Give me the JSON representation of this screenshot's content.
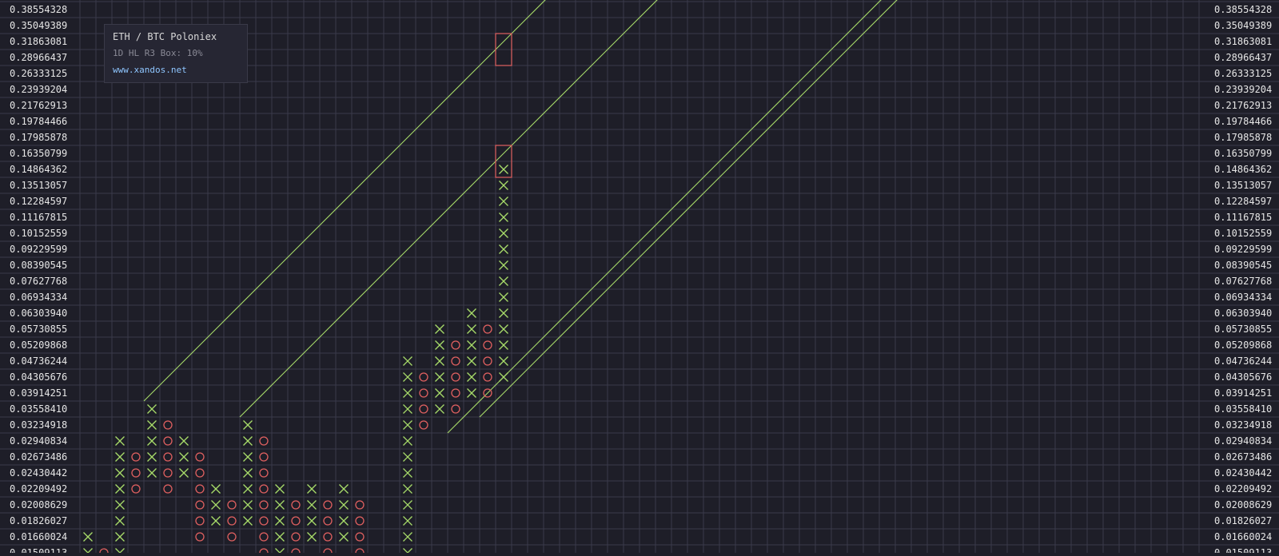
{
  "info": {
    "title": "ETH / BTC Poloniex",
    "subtitle": "1D HL R3 Box: 10%",
    "link": "www.xandos.net"
  },
  "colors": {
    "background": "#1e1e28",
    "grid": "#3a3a4a",
    "x_mark": "#a8dc6a",
    "o_mark": "#e06060",
    "trendline": "#a8dc6a",
    "target_box": "#e06060",
    "axis_text": "#e6e6e6"
  },
  "chart_data": {
    "type": "point-and-figure",
    "box_size": "10%",
    "y_axis_labels": [
      "0.38554328",
      "0.35049389",
      "0.31863081",
      "0.28966437",
      "0.26333125",
      "0.23939204",
      "0.21762913",
      "0.19784466",
      "0.17985878",
      "0.16350799",
      "0.14864362",
      "0.13513057",
      "0.12284597",
      "0.11167815",
      "0.10152559",
      "0.09229599",
      "0.08390545",
      "0.07627768",
      "0.06934334",
      "0.06303940",
      "0.05730855",
      "0.05209868",
      "0.04736244",
      "0.04305676",
      "0.03914251",
      "0.03558410",
      "0.03234918",
      "0.02940834",
      "0.02673486",
      "0.02430442",
      "0.02209492",
      "0.02008629",
      "0.01826027",
      "0.01660024",
      "0.01509113"
    ],
    "columns": [
      {
        "col": 0,
        "type": "X",
        "top": "0.01660024",
        "bottom": "0.01509113"
      },
      {
        "col": 1,
        "type": "O",
        "top": "0.01509113",
        "bottom": "0.01509113"
      },
      {
        "col": 2,
        "type": "X",
        "top": "0.02940834",
        "bottom": "0.01509113"
      },
      {
        "col": 3,
        "type": "O",
        "top": "0.02673486",
        "bottom": "0.02209492"
      },
      {
        "col": 4,
        "type": "X",
        "top": "0.03558410",
        "bottom": "0.02430442"
      },
      {
        "col": 5,
        "type": "O",
        "top": "0.03234918",
        "bottom": "0.02209492"
      },
      {
        "col": 6,
        "type": "X",
        "top": "0.02940834",
        "bottom": "0.02430442"
      },
      {
        "col": 7,
        "type": "O",
        "top": "0.02673486",
        "bottom": "0.01660024"
      },
      {
        "col": 8,
        "type": "X",
        "top": "0.02209492",
        "bottom": "0.01826027"
      },
      {
        "col": 9,
        "type": "O",
        "top": "0.02008629",
        "bottom": "0.01660024"
      },
      {
        "col": 10,
        "type": "X",
        "top": "0.03234918",
        "bottom": "0.01826027"
      },
      {
        "col": 11,
        "type": "O",
        "top": "0.02940834",
        "bottom": "0.01509113"
      },
      {
        "col": 12,
        "type": "X",
        "top": "0.02209492",
        "bottom": "0.01509113"
      },
      {
        "col": 13,
        "type": "O",
        "top": "0.02008629",
        "bottom": "0.01509113"
      },
      {
        "col": 14,
        "type": "X",
        "top": "0.02209492",
        "bottom": "0.01660024"
      },
      {
        "col": 15,
        "type": "O",
        "top": "0.02008629",
        "bottom": "0.01509113"
      },
      {
        "col": 16,
        "type": "X",
        "top": "0.02209492",
        "bottom": "0.01660024"
      },
      {
        "col": 17,
        "type": "O",
        "top": "0.02008629",
        "bottom": "0.01509113"
      },
      {
        "col": 20,
        "type": "X",
        "top": "0.04736244",
        "bottom": "0.01509113"
      },
      {
        "col": 21,
        "type": "O",
        "top": "0.04305676",
        "bottom": "0.03234918"
      },
      {
        "col": 22,
        "type": "X",
        "top": "0.05730855",
        "bottom": "0.03558410"
      },
      {
        "col": 23,
        "type": "O",
        "top": "0.05209868",
        "bottom": "0.03558410"
      },
      {
        "col": 24,
        "type": "X",
        "top": "0.06303940",
        "bottom": "0.03914251"
      },
      {
        "col": 25,
        "type": "O",
        "top": "0.05730855",
        "bottom": "0.03914251"
      },
      {
        "col": 26,
        "type": "X",
        "top": "0.14864362",
        "bottom": "0.04305676"
      }
    ],
    "target_boxes": [
      {
        "col": 26,
        "top": "0.31863081",
        "bottom": "0.28966437"
      },
      {
        "col": 26,
        "top": "0.16350799",
        "bottom": "0.14864362"
      }
    ],
    "trendlines": [
      {
        "direction": "up",
        "from": {
          "col": 4,
          "price": "0.03914251"
        },
        "to": {
          "col": 29,
          "price": "0.38554328"
        }
      },
      {
        "direction": "up",
        "from": {
          "col": 10,
          "price": "0.03558410"
        },
        "to": {
          "col": 36,
          "price": "0.38554328"
        }
      },
      {
        "direction": "up",
        "from": {
          "col": 23,
          "price": "0.03234918"
        },
        "to": {
          "col": 50,
          "price": "0.38554328"
        }
      },
      {
        "direction": "up",
        "from": {
          "col": 25,
          "price": "0.03558410"
        },
        "to": {
          "col": 51,
          "price": "0.38554328"
        }
      }
    ],
    "grid": true
  }
}
